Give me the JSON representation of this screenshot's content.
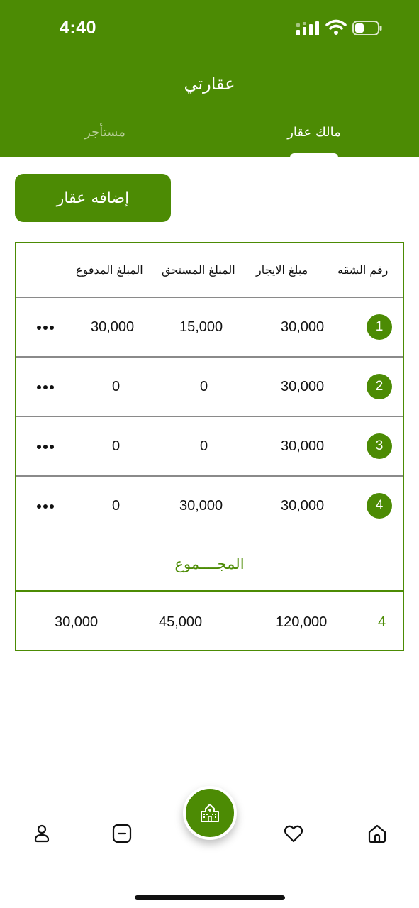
{
  "status": {
    "time": "4:40"
  },
  "header": {
    "title": "عقارتي",
    "tabs": [
      {
        "label": "مالك عقار",
        "active": true
      },
      {
        "label": "مستأجر",
        "active": false
      }
    ]
  },
  "actions": {
    "add_property_label": "إضافه عقار"
  },
  "table": {
    "columns": [
      "رقم الشقه",
      "مبلغ الايجار",
      "المبلغ المستحق",
      "المبلغ المدفوع"
    ],
    "rows": [
      {
        "number": "1",
        "rent": "30,000",
        "due": "15,000",
        "paid": "30,000"
      },
      {
        "number": "2",
        "rent": "30,000",
        "due": "0",
        "paid": "0"
      },
      {
        "number": "3",
        "rent": "30,000",
        "due": "0",
        "paid": "0"
      },
      {
        "number": "4",
        "rent": "30,000",
        "due": "30,000",
        "paid": "0"
      }
    ],
    "total_label": "المجــــموع",
    "totals": {
      "count": "4",
      "rent": "120,000",
      "due": "45,000",
      "paid": "30,000"
    }
  },
  "bottom_nav": {
    "items": [
      "profile-icon",
      "minus-square-icon",
      "building-icon",
      "heart-icon",
      "home-icon"
    ]
  },
  "colors": {
    "brand_green": "#4c8b04",
    "inactive_tab": "#b9cf9a"
  }
}
